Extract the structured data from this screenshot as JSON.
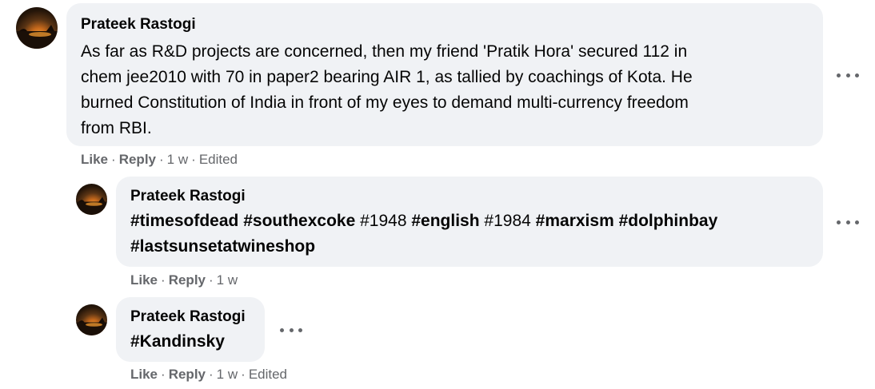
{
  "comments": [
    {
      "author": "Prateek Rastogi",
      "lines": [
        "As far as R&D projects are concerned, then my friend 'Pratik Hora' secured 112 in",
        "chem jee2010 with 70 in paper2 bearing AIR 1, as tallied by coachings of Kota. He",
        "burned Constitution of India in front of my eyes to demand multi-currency freedom",
        "from RBI."
      ],
      "actions": {
        "like": "Like",
        "reply": "Reply",
        "time": "1 w",
        "edited": "Edited"
      }
    },
    {
      "author": "Prateek Rastogi",
      "tags": {
        "t1": "#timesofdead",
        "t2": "#southexcoke",
        "t3": "#1948",
        "t4": "#english",
        "t5": "#1984",
        "t6": "#marxism",
        "t7": "#dolphinbay",
        "t8": "#lastsunsetatwineshop"
      },
      "actions": {
        "like": "Like",
        "reply": "Reply",
        "time": "1 w"
      }
    },
    {
      "author": "Prateek Rastogi",
      "tags": {
        "t1": "#Kandinsky"
      },
      "actions": {
        "like": "Like",
        "reply": "Reply",
        "time": "1 w",
        "edited": "Edited"
      }
    }
  ],
  "icons": {
    "avatar": "sunset-avatar",
    "more": "more-options-icon"
  },
  "colors": {
    "bubble": "#f0f2f5",
    "meta": "#65676b",
    "text": "#050505"
  }
}
